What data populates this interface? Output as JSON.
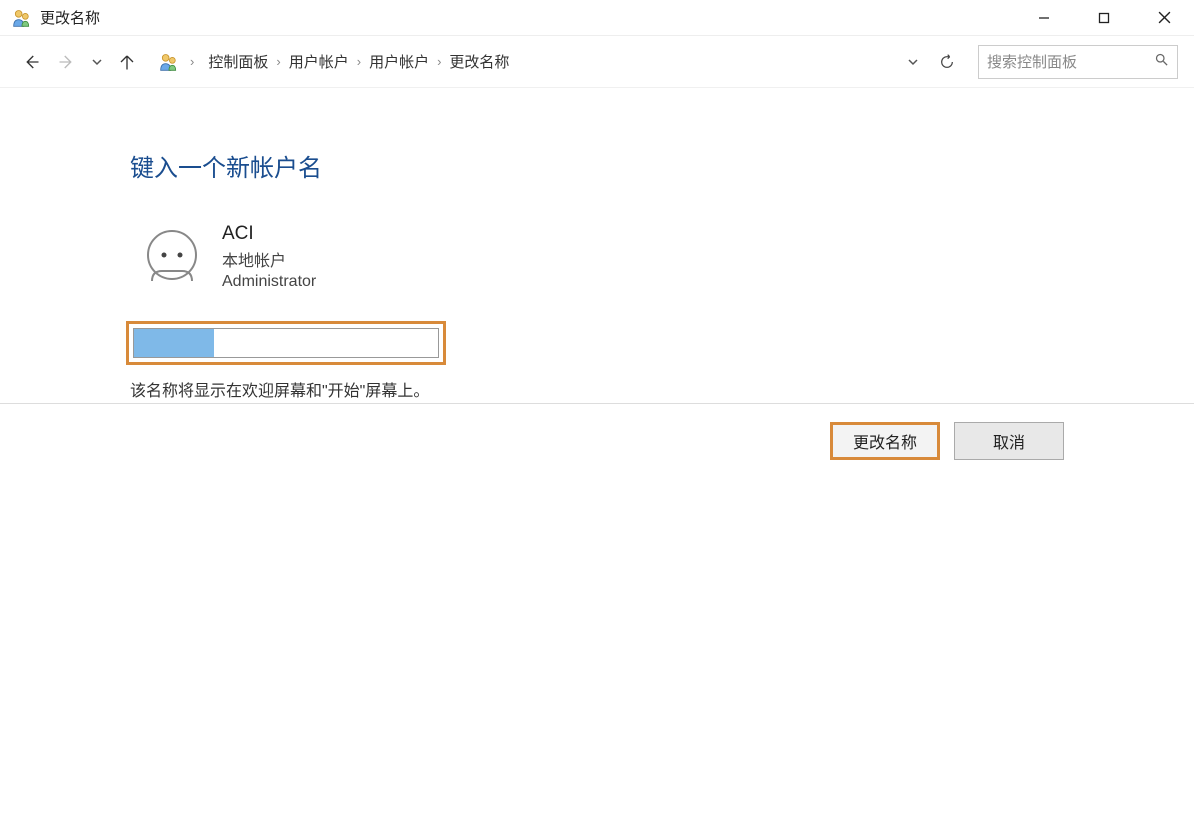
{
  "window": {
    "title": "更改名称",
    "minimize_label": "Minimize",
    "maximize_label": "Maximize",
    "close_label": "Close"
  },
  "nav": {
    "back_label": "Back",
    "forward_label": "Forward",
    "history_label": "Recent locations",
    "up_label": "Up"
  },
  "breadcrumb": {
    "items": [
      "控制面板",
      "用户帐户",
      "用户帐户",
      "更改名称"
    ]
  },
  "path_controls": {
    "refresh_label": "Refresh"
  },
  "search": {
    "placeholder": "搜索控制面板"
  },
  "page": {
    "heading": "键入一个新帐户名"
  },
  "user": {
    "name": "ACI",
    "type": "本地帐户",
    "role": "Administrator"
  },
  "input": {
    "value": "",
    "hint": "该名称将显示在欢迎屏幕和\"开始\"屏幕上。"
  },
  "actions": {
    "change": "更改名称",
    "cancel": "取消"
  }
}
